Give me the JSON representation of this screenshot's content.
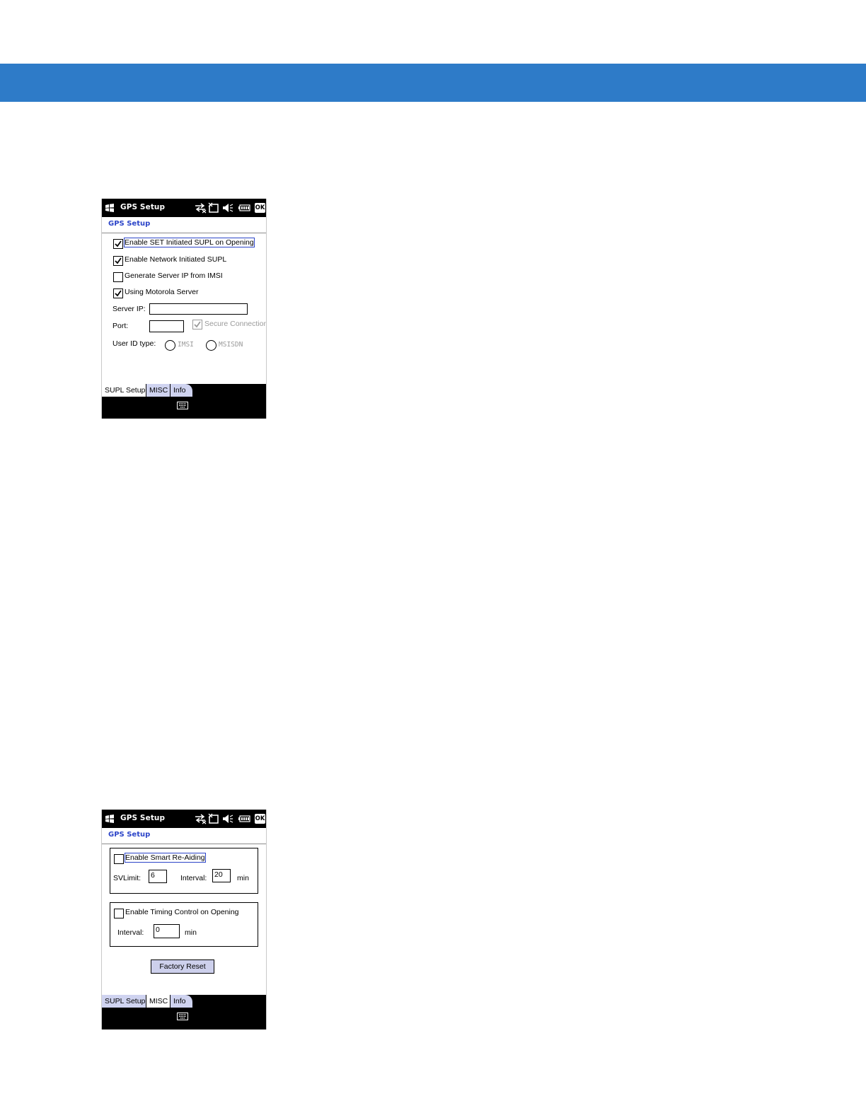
{
  "screens": [
    {
      "status_bar": {
        "title": "GPS Setup",
        "ok_label": "OK"
      },
      "header": "GPS Setup",
      "options": [
        {
          "label": "Enable SET Initiated SUPL on Opening",
          "checked": true
        },
        {
          "label": "Enable Network Initiated SUPL",
          "checked": true
        },
        {
          "label": "Generate Server IP from IMSI",
          "checked": false
        },
        {
          "label": "Using Motorola Server",
          "checked": true
        }
      ],
      "server_ip_label": "Server IP:",
      "server_ip_value": "",
      "port_label": "Port:",
      "port_value": "",
      "secure_connection_label": "Secure Connection",
      "secure_connection_checked": true,
      "user_id_type_label": "User ID type:",
      "user_id_options": [
        "IMSI",
        "MSISDN"
      ],
      "tabs": [
        {
          "label": "SUPL Setup",
          "active": true
        },
        {
          "label": "MISC",
          "active": false
        },
        {
          "label": "Info",
          "active": false
        }
      ]
    },
    {
      "status_bar": {
        "title": "GPS Setup",
        "ok_label": "OK"
      },
      "header": "GPS Setup",
      "smart_reaiding": {
        "label": "Enable Smart Re-Aiding",
        "checked": false,
        "svlimit_label": "SVLimit:",
        "svlimit_value": "6",
        "interval_label": "Interval:",
        "interval_value": "20",
        "unit": "min"
      },
      "timing_control": {
        "label": "Enable Timing Control on Opening",
        "checked": false,
        "interval_label": "Interval:",
        "interval_value": "0",
        "unit": "min"
      },
      "factory_reset_label": "Factory Reset",
      "tabs": [
        {
          "label": "SUPL Setup",
          "active": false
        },
        {
          "label": "MISC",
          "active": true
        },
        {
          "label": "Info",
          "active": false
        }
      ]
    }
  ]
}
